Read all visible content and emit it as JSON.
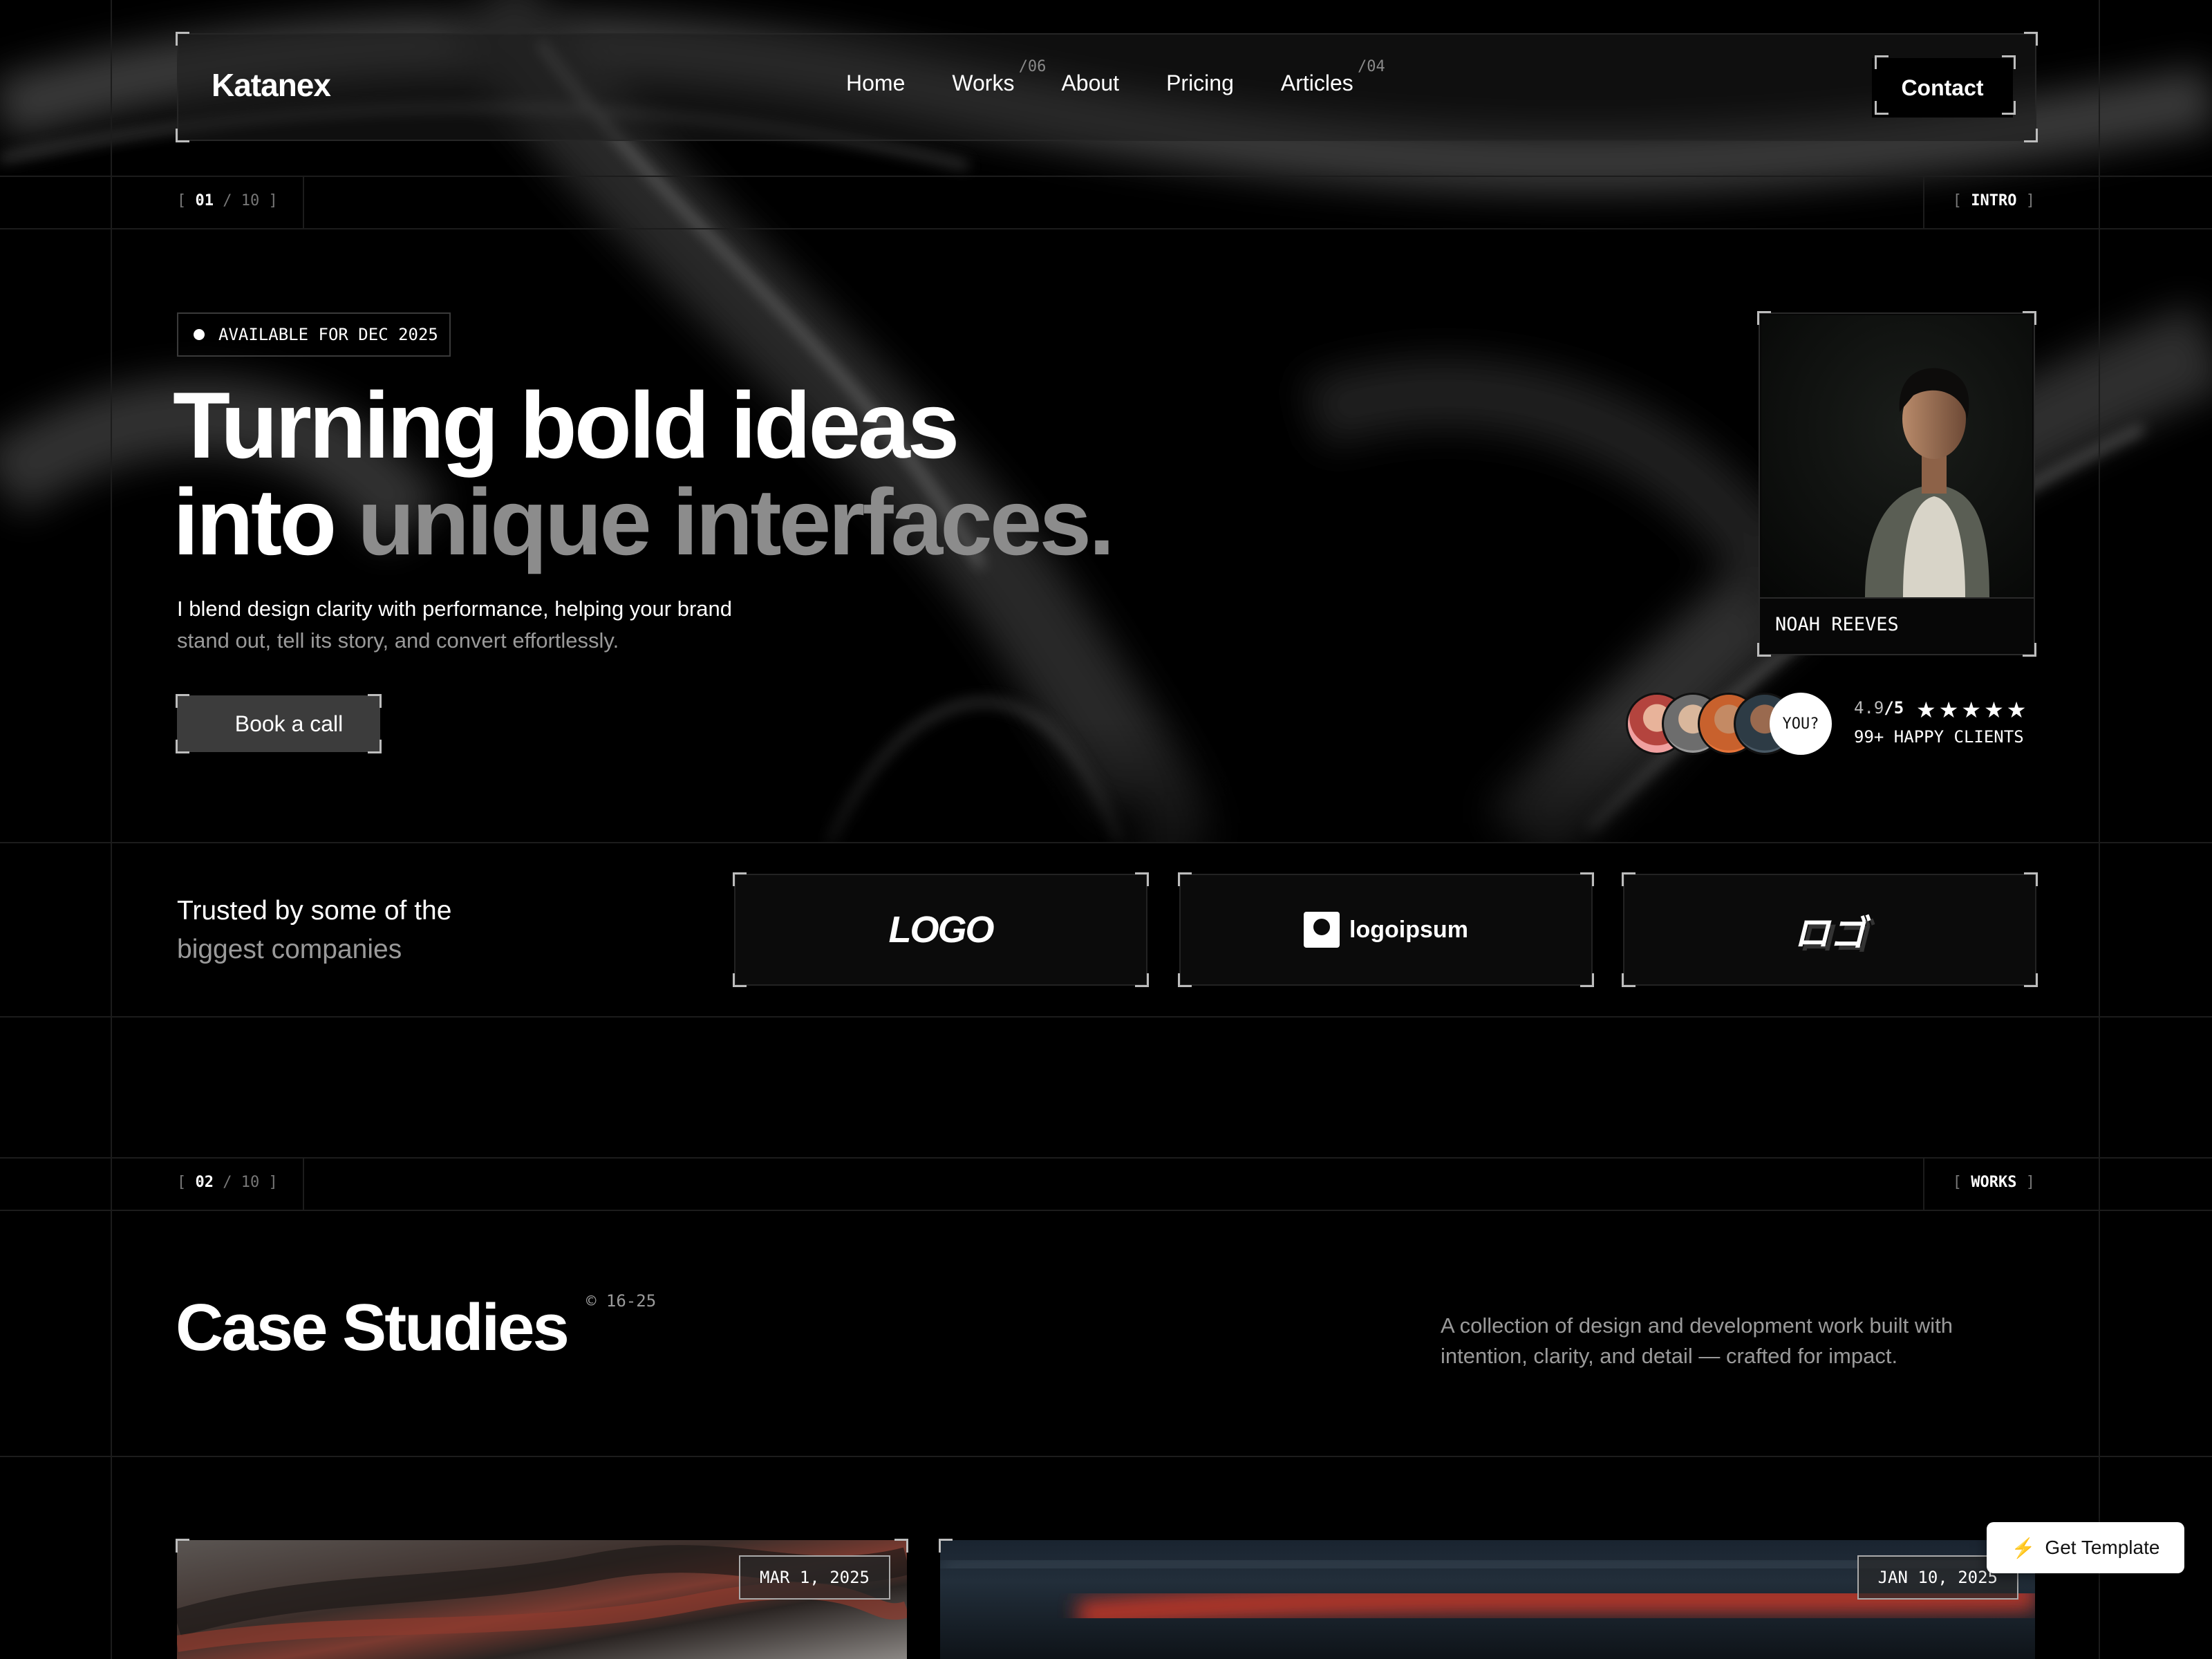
{
  "brand": {
    "name": "Katanex"
  },
  "nav": {
    "items": [
      {
        "label": "Home",
        "sup": ""
      },
      {
        "label": "Works",
        "sup": "/06"
      },
      {
        "label": "About",
        "sup": ""
      },
      {
        "label": "Pricing",
        "sup": ""
      },
      {
        "label": "Articles",
        "sup": "/04"
      }
    ],
    "contact_label": "Contact"
  },
  "intro_section": {
    "num_current": "01",
    "num_sep": "/ 10",
    "tag": "INTRO"
  },
  "hero": {
    "badge": "AVAILABLE FOR DEC 2025",
    "headline_line1": "Turning bold ideas",
    "headline_line2_a": "into ",
    "headline_line2_b": "unique interfaces.",
    "sub_a": "I blend design clarity with performance, helping your brand",
    "sub_b": " stand out, tell its story, and convert effortlessly.",
    "cta_label": "Book a call"
  },
  "profile": {
    "name": "NOAH REEVES"
  },
  "social_proof": {
    "you_label": "YOU?",
    "rating_value": "4.9",
    "rating_max": "/5",
    "stars": "★★★★★",
    "clients_label": "99+ HAPPY CLIENTS"
  },
  "trusted": {
    "line1": "Trusted by some of the",
    "line2": "biggest companies",
    "logos": [
      {
        "icon": "logo-wordmark-italic",
        "text": "LOGO"
      },
      {
        "icon": "logoipsum-icon",
        "text": "logoipsum"
      },
      {
        "icon": "logo-katakana",
        "text": "ロゴ"
      }
    ]
  },
  "works_section": {
    "num_current": "02",
    "num_sep": "/ 10",
    "tag": "WORKS"
  },
  "case_studies": {
    "title": "Case Studies",
    "copyright": "© 16-25",
    "description": "A collection of design and development work built with intention, clarity, and detail — crafted for impact.",
    "cards": [
      {
        "date": "MAR 1, 2025"
      },
      {
        "date": "JAN 10, 2025"
      }
    ]
  },
  "floating": {
    "get_template_label": "Get Template",
    "icon": "bolt-icon"
  }
}
